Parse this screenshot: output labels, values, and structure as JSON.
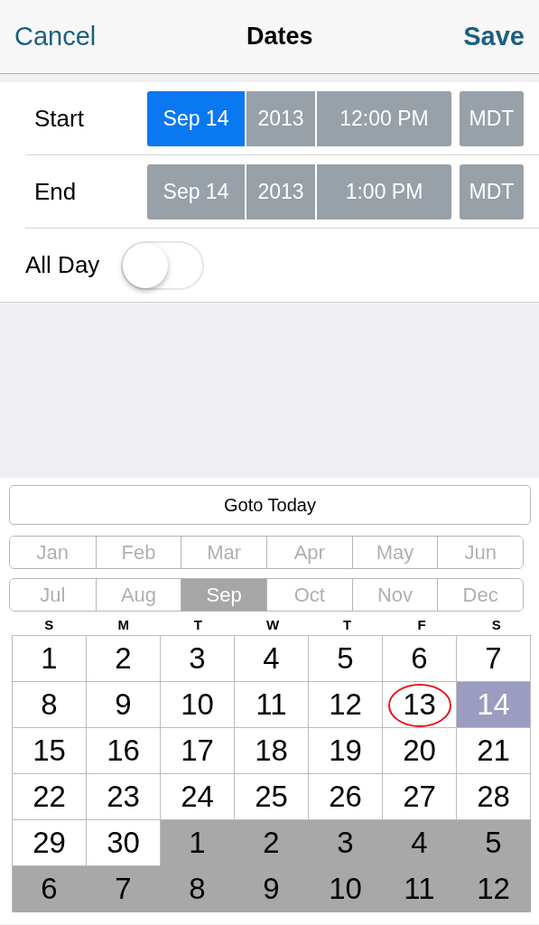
{
  "nav": {
    "cancel": "Cancel",
    "title": "Dates",
    "save": "Save"
  },
  "rows": [
    {
      "label": "Start",
      "fields": [
        {
          "text": "Sep 14",
          "selected": true
        },
        {
          "text": "2013",
          "selected": false
        },
        {
          "text": "12:00 PM",
          "selected": false
        }
      ],
      "zone": {
        "text": "MDT",
        "selected": false
      }
    },
    {
      "label": "End",
      "fields": [
        {
          "text": "Sep 14",
          "selected": false
        },
        {
          "text": "2013",
          "selected": false
        },
        {
          "text": "1:00 PM",
          "selected": false
        }
      ],
      "zone": {
        "text": "MDT",
        "selected": false
      }
    }
  ],
  "all_day": {
    "label": "All Day",
    "on": false
  },
  "calendar": {
    "today_button": "Goto Today",
    "months": [
      {
        "label": "Jan",
        "selected": false
      },
      {
        "label": "Feb",
        "selected": false
      },
      {
        "label": "Mar",
        "selected": false
      },
      {
        "label": "Apr",
        "selected": false
      },
      {
        "label": "May",
        "selected": false
      },
      {
        "label": "Jun",
        "selected": false
      },
      {
        "label": "Jul",
        "selected": false
      },
      {
        "label": "Aug",
        "selected": false
      },
      {
        "label": "Sep",
        "selected": true
      },
      {
        "label": "Oct",
        "selected": false
      },
      {
        "label": "Nov",
        "selected": false
      },
      {
        "label": "Dec",
        "selected": false
      }
    ],
    "weekdays": [
      "S",
      "M",
      "T",
      "W",
      "T",
      "F",
      "S"
    ],
    "days": [
      {
        "label": "1",
        "kind": "current",
        "selected": false,
        "today": false
      },
      {
        "label": "2",
        "kind": "current",
        "selected": false,
        "today": false
      },
      {
        "label": "3",
        "kind": "current",
        "selected": false,
        "today": false
      },
      {
        "label": "4",
        "kind": "current",
        "selected": false,
        "today": false
      },
      {
        "label": "5",
        "kind": "current",
        "selected": false,
        "today": false
      },
      {
        "label": "6",
        "kind": "current",
        "selected": false,
        "today": false
      },
      {
        "label": "7",
        "kind": "current",
        "selected": false,
        "today": false
      },
      {
        "label": "8",
        "kind": "current",
        "selected": false,
        "today": false
      },
      {
        "label": "9",
        "kind": "current",
        "selected": false,
        "today": false
      },
      {
        "label": "10",
        "kind": "current",
        "selected": false,
        "today": false
      },
      {
        "label": "11",
        "kind": "current",
        "selected": false,
        "today": false
      },
      {
        "label": "12",
        "kind": "current",
        "selected": false,
        "today": false
      },
      {
        "label": "13",
        "kind": "current",
        "selected": false,
        "today": true
      },
      {
        "label": "14",
        "kind": "current",
        "selected": true,
        "today": false
      },
      {
        "label": "15",
        "kind": "current",
        "selected": false,
        "today": false
      },
      {
        "label": "16",
        "kind": "current",
        "selected": false,
        "today": false
      },
      {
        "label": "17",
        "kind": "current",
        "selected": false,
        "today": false
      },
      {
        "label": "18",
        "kind": "current",
        "selected": false,
        "today": false
      },
      {
        "label": "19",
        "kind": "current",
        "selected": false,
        "today": false
      },
      {
        "label": "20",
        "kind": "current",
        "selected": false,
        "today": false
      },
      {
        "label": "21",
        "kind": "current",
        "selected": false,
        "today": false
      },
      {
        "label": "22",
        "kind": "current",
        "selected": false,
        "today": false
      },
      {
        "label": "23",
        "kind": "current",
        "selected": false,
        "today": false
      },
      {
        "label": "24",
        "kind": "current",
        "selected": false,
        "today": false
      },
      {
        "label": "25",
        "kind": "current",
        "selected": false,
        "today": false
      },
      {
        "label": "26",
        "kind": "current",
        "selected": false,
        "today": false
      },
      {
        "label": "27",
        "kind": "current",
        "selected": false,
        "today": false
      },
      {
        "label": "28",
        "kind": "current",
        "selected": false,
        "today": false
      },
      {
        "label": "29",
        "kind": "current",
        "selected": false,
        "today": false
      },
      {
        "label": "30",
        "kind": "current",
        "selected": false,
        "today": false
      },
      {
        "label": "1",
        "kind": "other",
        "selected": false,
        "today": false
      },
      {
        "label": "2",
        "kind": "other",
        "selected": false,
        "today": false
      },
      {
        "label": "3",
        "kind": "other",
        "selected": false,
        "today": false
      },
      {
        "label": "4",
        "kind": "other",
        "selected": false,
        "today": false
      },
      {
        "label": "5",
        "kind": "other",
        "selected": false,
        "today": false
      },
      {
        "label": "6",
        "kind": "other",
        "selected": false,
        "today": false
      },
      {
        "label": "7",
        "kind": "other",
        "selected": false,
        "today": false
      },
      {
        "label": "8",
        "kind": "other",
        "selected": false,
        "today": false
      },
      {
        "label": "9",
        "kind": "other",
        "selected": false,
        "today": false
      },
      {
        "label": "10",
        "kind": "other",
        "selected": false,
        "today": false
      },
      {
        "label": "11",
        "kind": "other",
        "selected": false,
        "today": false
      },
      {
        "label": "12",
        "kind": "other",
        "selected": false,
        "today": false
      }
    ]
  }
}
